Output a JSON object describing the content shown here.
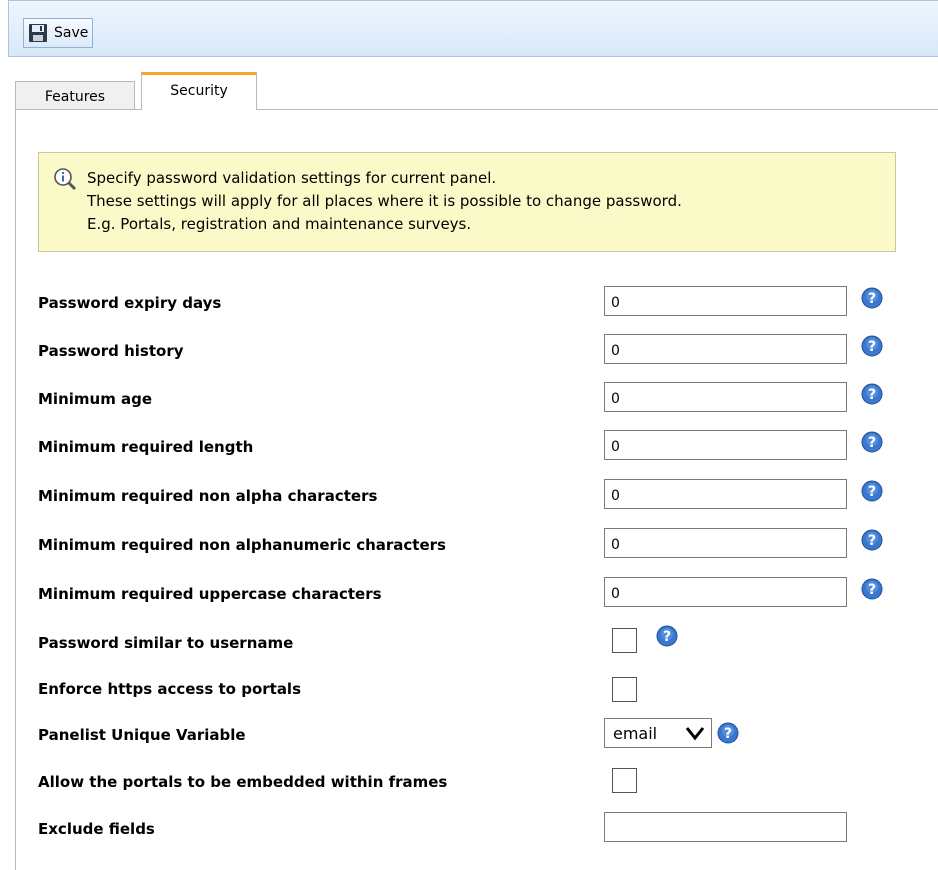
{
  "toolbar": {
    "save_label": "Save"
  },
  "tabs": [
    {
      "label": "Features",
      "active": false
    },
    {
      "label": "Security",
      "active": true
    }
  ],
  "info": {
    "lines": [
      "Specify password validation settings for current panel.",
      "These settings will apply for all places where it is possible to change password.",
      "E.g. Portals, registration and maintenance surveys."
    ]
  },
  "fields": [
    {
      "label": "Password expiry days",
      "value": "0"
    },
    {
      "label": "Password history",
      "value": "0"
    },
    {
      "label": "Minimum age",
      "value": "0"
    },
    {
      "label": "Minimum required length",
      "value": "0"
    },
    {
      "label": "Minimum required non alpha characters",
      "value": "0"
    },
    {
      "label": "Minimum required non alphanumeric characters",
      "value": "0"
    },
    {
      "label": "Minimum required uppercase characters",
      "value": "0"
    },
    {
      "label": "Password similar to username",
      "checked": false
    },
    {
      "label": "Enforce https access to portals",
      "checked": false
    },
    {
      "label": "Panelist Unique Variable",
      "selected": "email"
    },
    {
      "label": "Allow the portals to be embedded within frames",
      "checked": false
    },
    {
      "label": "Exclude fields",
      "value": ""
    }
  ],
  "colors": {
    "accent_tab": "#f5a623",
    "info_bg": "#fafac9",
    "toolbar_bg": "#d8e8f8",
    "help_icon": "#3a78d0"
  },
  "icons": {
    "save": "floppy-disk-icon",
    "info": "magnifier-info-icon",
    "help": "help-question-icon",
    "dropdown": "chevron-down-icon"
  }
}
